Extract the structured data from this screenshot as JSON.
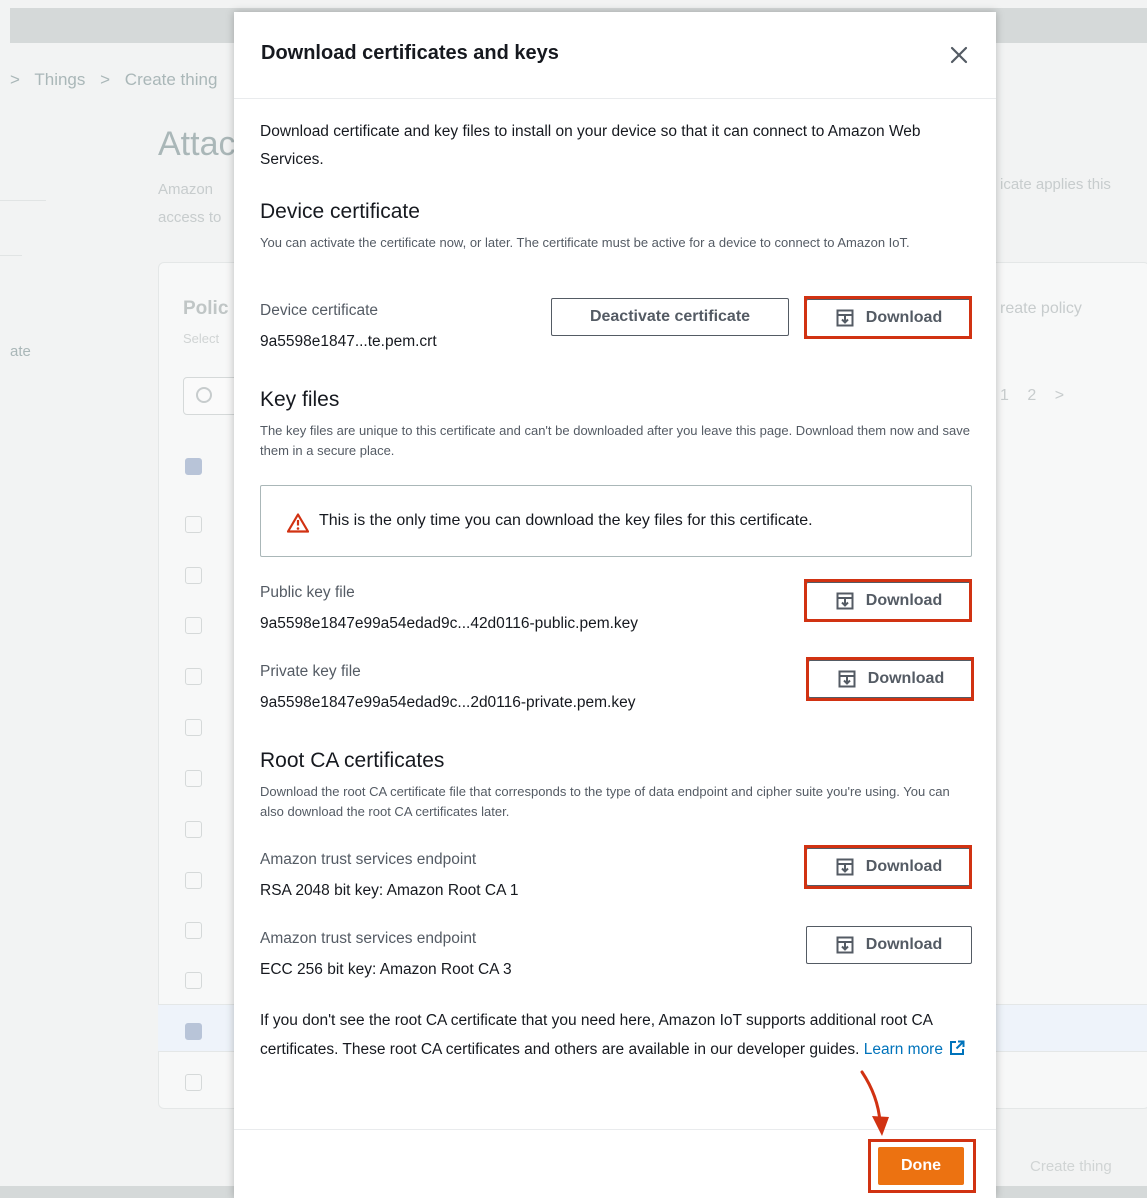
{
  "background": {
    "breadcrumb": [
      ">",
      "Things",
      ">",
      "Create thing"
    ],
    "page_title": "Attach",
    "desc_line1": "Amazon",
    "desc_line2": "access to",
    "desc_right": "icate applies this",
    "sidebar_text": "ate",
    "policies_title": "Polic",
    "policies_select": "Select",
    "create_policy": "reate policy",
    "pager": "1 2 >",
    "create_thing": "Create thing"
  },
  "modal": {
    "title": "Download certificates and keys",
    "close_icon": "close-icon",
    "intro": "Download certificate and key files to install on your device so that it can connect to Amazon Web Services.",
    "device_certificate": {
      "heading": "Device certificate",
      "description": "You can activate the certificate now, or later. The certificate must be active for a device to connect to Amazon IoT.",
      "label": "Device certificate",
      "file": "9a5598e1847...te.pem.crt",
      "deactivate_label": "Deactivate certificate",
      "download_label": "Download"
    },
    "key_files": {
      "heading": "Key files",
      "description": "The key files are unique to this certificate and can't be downloaded after you leave this page. Download them now and save them in a secure place.",
      "warning": "This is the only time you can download the key files for this certificate.",
      "public_label": "Public key file",
      "public_file": "9a5598e1847e99a54edad9c...42d0116-public.pem.key",
      "public_download": "Download",
      "private_label": "Private key file",
      "private_file": "9a5598e1847e99a54edad9c...2d0116-private.pem.key",
      "private_download": "Download"
    },
    "root_ca": {
      "heading": "Root CA certificates",
      "description": "Download the root CA certificate file that corresponds to the type of data endpoint and cipher suite you're using. You can also download the root CA certificates later.",
      "ca1_label": "Amazon trust services endpoint",
      "ca1_value": "RSA 2048 bit key: Amazon Root CA 1",
      "ca1_download": "Download",
      "ca3_label": "Amazon trust services endpoint",
      "ca3_value": "ECC 256 bit key: Amazon Root CA 3",
      "ca3_download": "Download"
    },
    "footer_note": "If you don't see the root CA certificate that you need here, Amazon IoT supports additional root CA certificates. These root CA certificates and others are available in our developer guides.",
    "learn_more": "Learn more",
    "done_label": "Done"
  },
  "colors": {
    "accent_orange": "#ec7211",
    "highlight_red": "#d13212",
    "link_blue": "#0073bb",
    "warning_red": "#d13212"
  }
}
